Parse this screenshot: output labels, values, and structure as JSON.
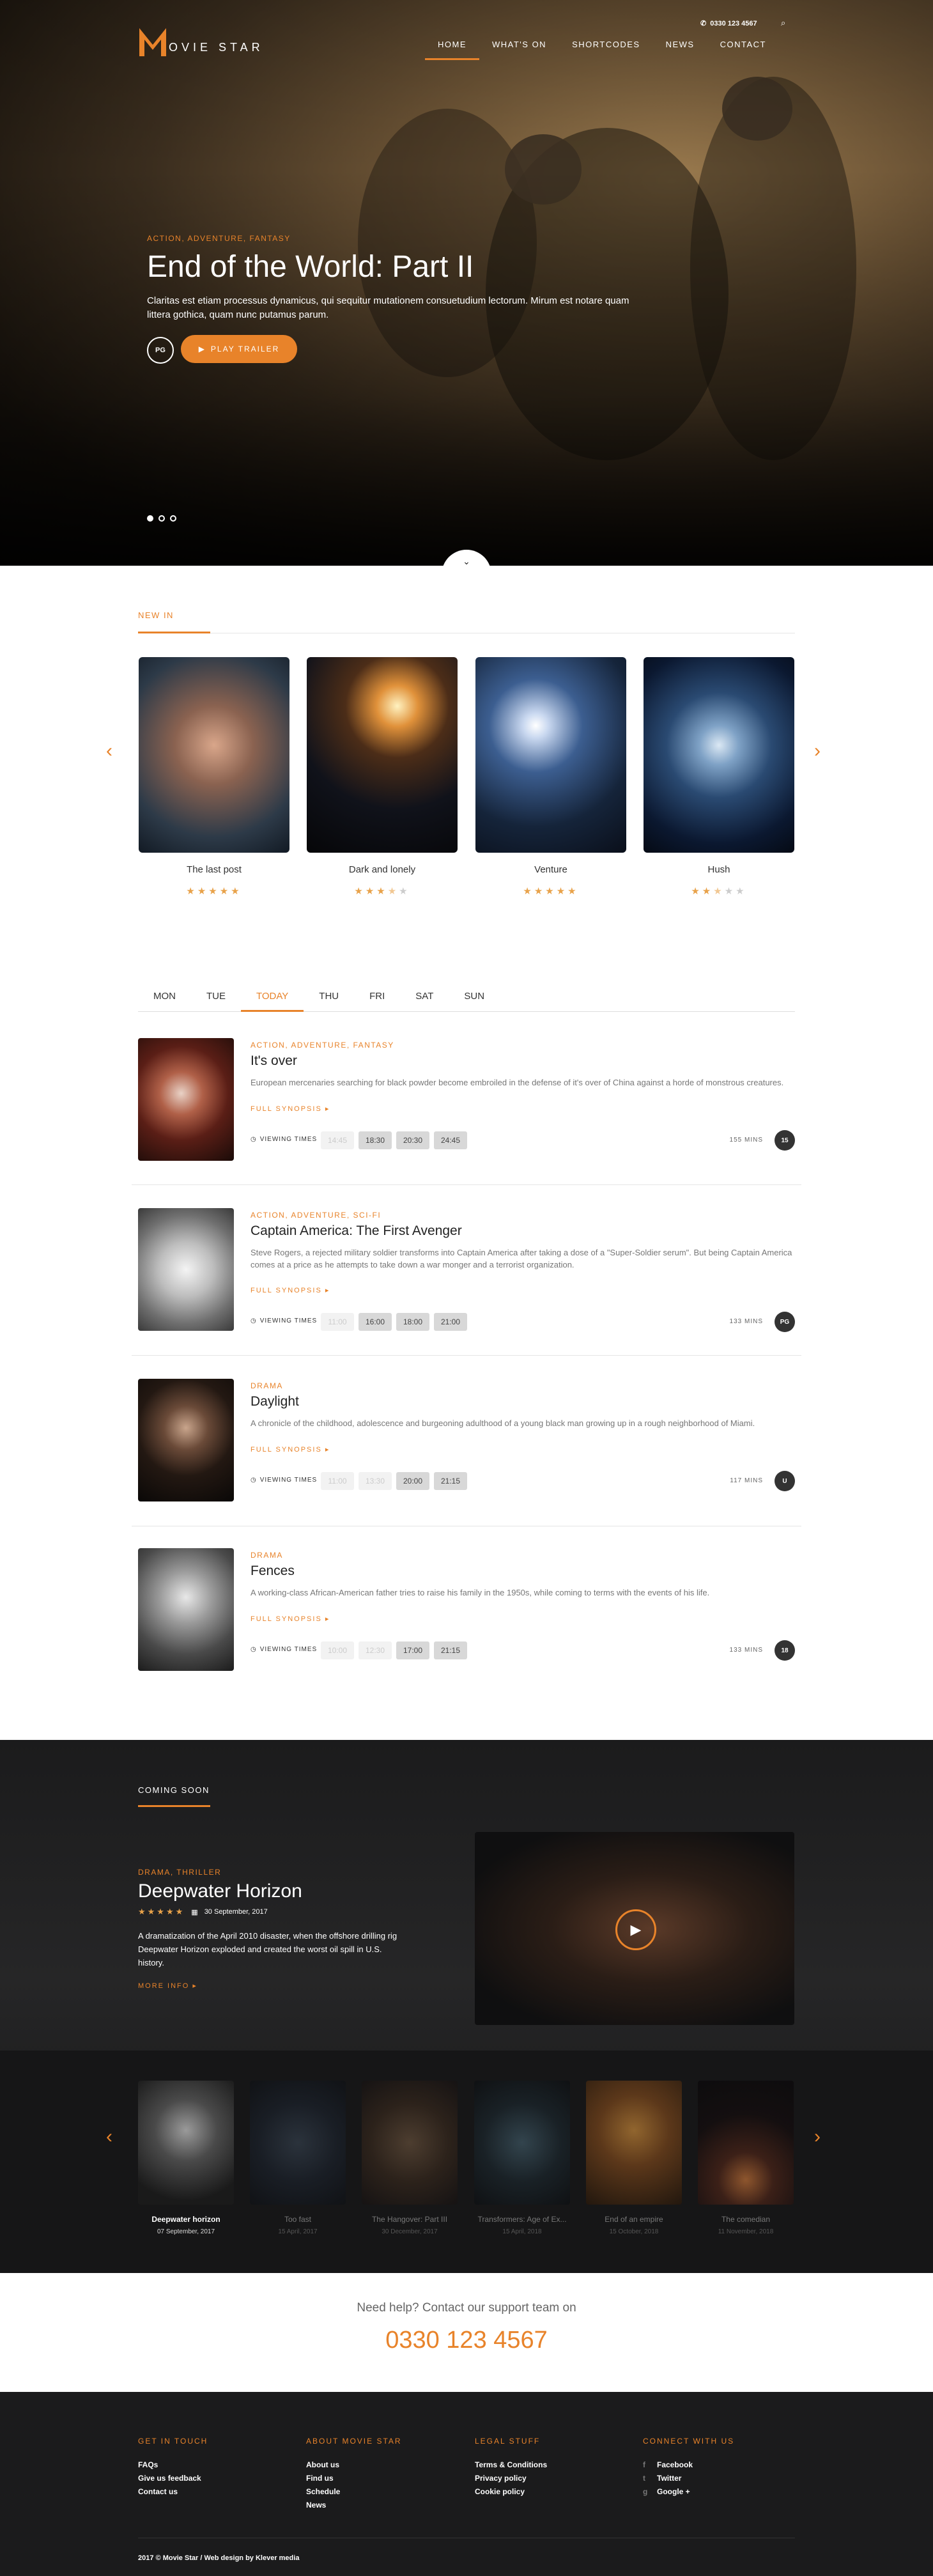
{
  "header": {
    "logo_text": "ovie star",
    "phone": "0330 123 4567",
    "nav": [
      "HOME",
      "WHAT'S ON",
      "SHORTCODES",
      "NEWS",
      "CONTACT"
    ]
  },
  "hero": {
    "genre": "ACTION, ADVENTURE, FANTASY",
    "title": "End of the World: Part II",
    "description": "Claritas est etiam processus dynamicus, qui sequitur mutationem consuetudium lectorum. Mirum est notare quam littera gothica, quam nunc putamus parum.",
    "rating": "PG",
    "trailer_label": "PLAY TRAILER"
  },
  "new_in": {
    "title": "NEW IN",
    "movies": [
      {
        "title": "The last post",
        "stars": 5
      },
      {
        "title": "Dark and lonely",
        "stars": 3.5
      },
      {
        "title": "Venture",
        "stars": 5
      },
      {
        "title": "Hush",
        "stars": 2.5
      }
    ]
  },
  "schedule": {
    "days": [
      "MON",
      "TUE",
      "TODAY",
      "THU",
      "FRI",
      "SAT",
      "SUN"
    ],
    "synopsis_label": "FULL SYNOPSIS ▸",
    "viewing_label": "VIEWING TIMES",
    "movies": [
      {
        "genre": "ACTION, ADVENTURE, FANTASY",
        "title": "It's over",
        "desc": "European mercenaries searching for black powder become embroiled in the defense of it's over of China against a horde of monstrous creatures.",
        "times": [
          "14:45",
          "18:30",
          "20:30",
          "24:45"
        ],
        "past": 1,
        "mins": "155 MINS",
        "rating": "15"
      },
      {
        "genre": "ACTION, ADVENTURE, SCI-FI",
        "title": "Captain America: The First Avenger",
        "desc": "Steve Rogers, a rejected military soldier transforms into Captain America after taking a dose of a \"Super-Soldier serum\". But being Captain America comes at a price as he attempts to take down a war monger and a terrorist organization.",
        "times": [
          "11:00",
          "16:00",
          "18:00",
          "21:00"
        ],
        "past": 1,
        "mins": "133 MINS",
        "rating": "PG"
      },
      {
        "genre": "DRAMA",
        "title": "Daylight",
        "desc": "A chronicle of the childhood, adolescence and burgeoning adulthood of a young black man growing up in a rough neighborhood of Miami.",
        "times": [
          "11:00",
          "13:30",
          "20:00",
          "21:15"
        ],
        "past": 2,
        "mins": "117 MINS",
        "rating": "U"
      },
      {
        "genre": "DRAMA",
        "title": "Fences",
        "desc": "A working-class African-American father tries to raise his family in the 1950s, while coming to terms with the events of his life.",
        "times": [
          "10:00",
          "12:30",
          "17:00",
          "21:15"
        ],
        "past": 2,
        "mins": "133 MINS",
        "rating": "18"
      }
    ]
  },
  "coming_soon": {
    "title": "COMING SOON",
    "genre": "DRAMA, THRILLER",
    "movie_title": "Deepwater Horizon",
    "stars": 5,
    "date": "30 September, 2017",
    "desc": "A dramatization of the April 2010 disaster, when the offshore drilling rig Deepwater Horizon exploded and created the worst oil spill in U.S. history.",
    "more": "MORE INFO ▸",
    "list": [
      {
        "title": "Deepwater horizon",
        "date": "07 September, 2017"
      },
      {
        "title": "Too fast",
        "date": "15 April, 2017"
      },
      {
        "title": "The Hangover: Part III",
        "date": "30 December, 2017"
      },
      {
        "title": "Transformers: Age of Ex...",
        "date": "15 April, 2018"
      },
      {
        "title": "End of an empire",
        "date": "15 October, 2018"
      },
      {
        "title": "The comedian",
        "date": "11 November, 2018"
      }
    ]
  },
  "help": {
    "text": "Need help? Contact our support team on",
    "phone": "0330 123 4567"
  },
  "footer": {
    "cols": [
      {
        "title": "GET IN TOUCH",
        "links": [
          "FAQs",
          "Give us feedback",
          "Contact us"
        ]
      },
      {
        "title": "ABOUT MOVIE STAR",
        "links": [
          "About us",
          "Find us",
          "Schedule",
          "News"
        ]
      },
      {
        "title": "LEGAL STUFF",
        "links": [
          "Terms & Conditions",
          "Privacy policy",
          "Cookie policy"
        ]
      },
      {
        "title": "CONNECT WITH US",
        "links": [
          "Facebook",
          "Twitter",
          "Google +"
        ]
      }
    ],
    "copyright": "2017 © Movie Star / Web design by Klever media"
  },
  "colors": {
    "accent": "#e8832a",
    "dark": "#1b1b1c"
  }
}
